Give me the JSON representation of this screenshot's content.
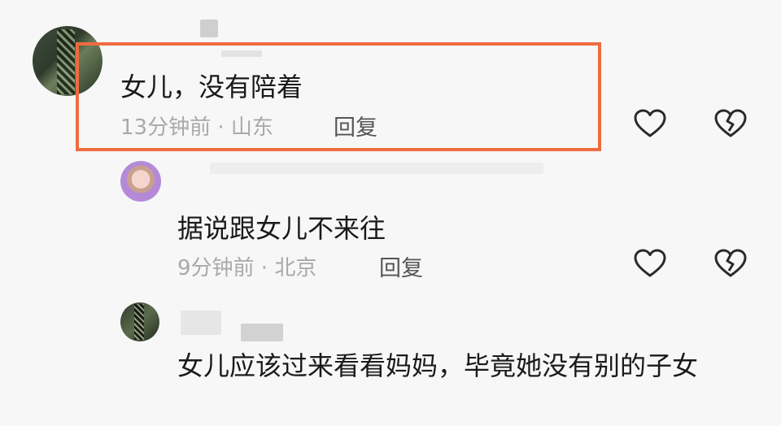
{
  "comments": [
    {
      "text": "女儿，没有陪着",
      "time": "13分钟前",
      "location": "山东",
      "reply_label": "回复",
      "highlighted": true,
      "highlight_color": "#ef6b3f"
    },
    {
      "text": "据说跟女儿不来往",
      "time": "9分钟前",
      "location": "北京",
      "reply_label": "回复"
    },
    {
      "text": "女儿应该过来看看妈妈，毕竟她没有别的子女"
    }
  ],
  "separator": " · ",
  "icons": {
    "like": "heart-outline-icon",
    "dislike": "broken-heart-icon"
  }
}
